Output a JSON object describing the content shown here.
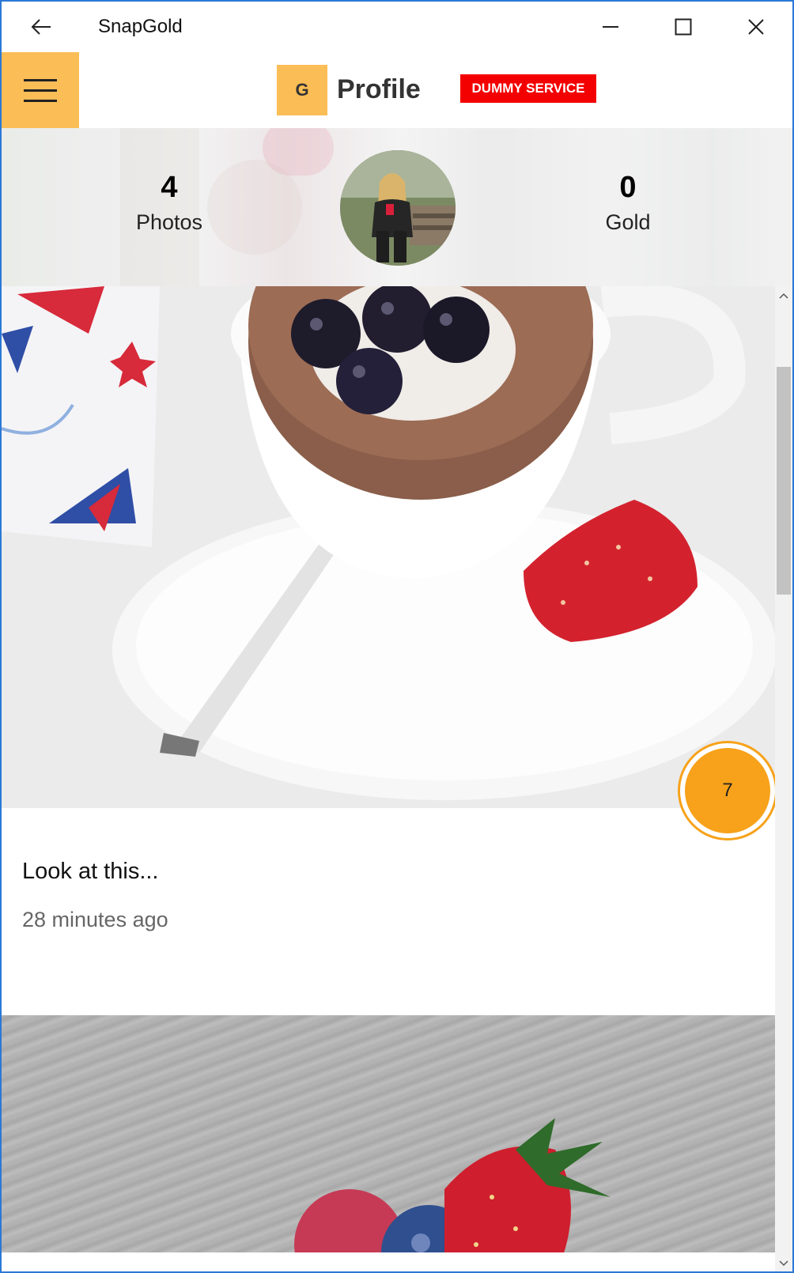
{
  "window": {
    "title": "SnapGold",
    "border_color": "#2b78d6"
  },
  "header": {
    "logo_letter": "G",
    "title": "Profile",
    "badge": "DUMMY SERVICE",
    "accent_color": "#fbbd55",
    "badge_color": "#f30000"
  },
  "profile": {
    "photos_count": "4",
    "photos_label": "Photos",
    "gold_count": "0",
    "gold_label": "Gold"
  },
  "posts": [
    {
      "caption": "Look at this...",
      "time": "28 minutes ago",
      "gold": "7"
    }
  ],
  "icons": {
    "back": "back-arrow-icon",
    "minimize": "minimize-icon",
    "maximize": "maximize-icon",
    "close": "close-icon",
    "menu": "hamburger-menu-icon"
  }
}
